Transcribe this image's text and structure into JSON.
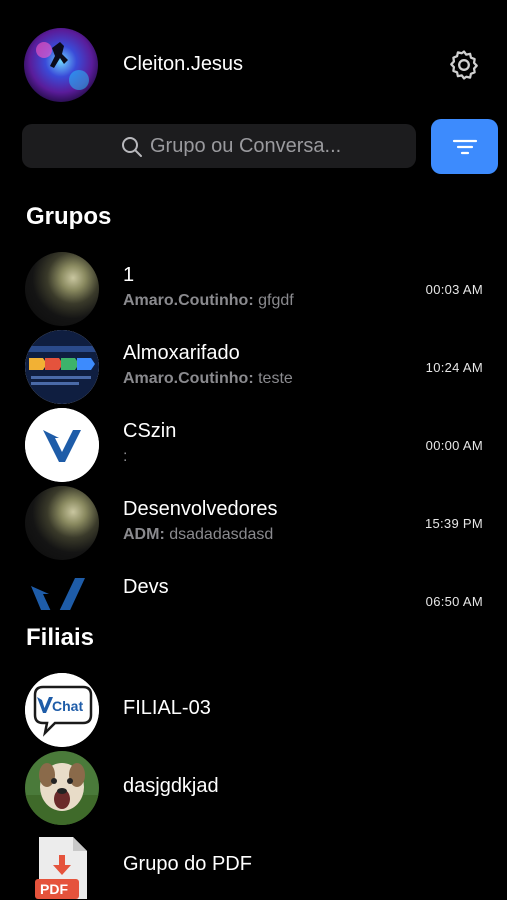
{
  "header": {
    "username": "Cleiton.Jesus"
  },
  "search": {
    "placeholder": "Grupo ou Conversa..."
  },
  "sections": {
    "groups_title": "Grupos",
    "branches_title": "Filiais"
  },
  "groups": [
    {
      "name": "1",
      "sender": "Amaro.Coutinho:",
      "message": "gfgdf",
      "time": "00:03 AM"
    },
    {
      "name": "Almoxarifado",
      "sender": "Amaro.Coutinho:",
      "message": "teste",
      "time": "10:24 AM"
    },
    {
      "name": "CSzin",
      "sender": "",
      "message": ":",
      "time": "00:00 AM"
    },
    {
      "name": "Desenvolvedores",
      "sender": "ADM:",
      "message": "dsadadasdasd",
      "time": "15:39 PM"
    },
    {
      "name": "Devs",
      "sender": "",
      "message": "",
      "time": "06:50 AM"
    }
  ],
  "branches": [
    {
      "name": "FILIAL-03",
      "avatar_text": "Chat"
    },
    {
      "name": "dasjgdkjad"
    },
    {
      "name": "Grupo do PDF",
      "avatar_text": "PDF"
    }
  ],
  "colors": {
    "accent": "#3d8bfd",
    "brand_blue": "#1e5ca8",
    "pdf_red": "#e5533c"
  }
}
